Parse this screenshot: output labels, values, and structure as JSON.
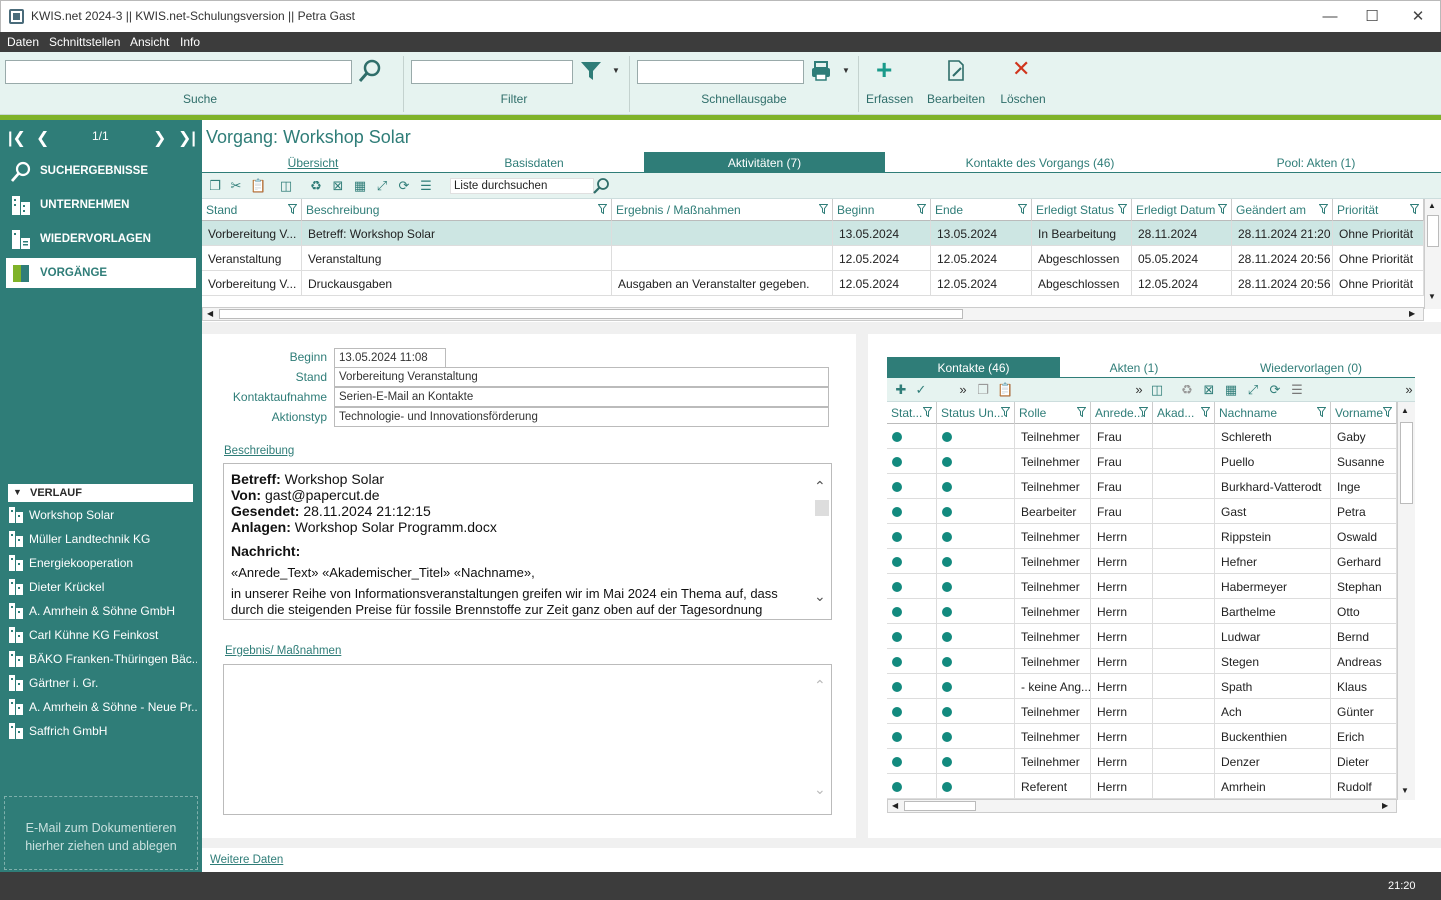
{
  "window": {
    "title": "KWIS.net 2024-3 || KWIS.net-Schulungsversion || Petra Gast"
  },
  "menu": [
    "Daten",
    "Schnittstellen",
    "Ansicht",
    "Info"
  ],
  "toolbar": {
    "search_label": "Suche",
    "filter_label": "Filter",
    "quick_label": "Schnellausgabe",
    "add_label": "Erfassen",
    "edit_label": "Bearbeiten",
    "delete_label": "Löschen"
  },
  "nav": {
    "pager": "1/1",
    "items": [
      "SUCHERGEBNISSE",
      "UNTERNEHMEN",
      "WIEDERVORLAGEN",
      "VORGÄNGE"
    ],
    "verlauf": "VERLAUF",
    "history": [
      "Workshop Solar",
      "Müller Landtechnik KG",
      "Energiekooperation",
      "Dieter Krückel",
      "A. Amrhein & Söhne GmbH",
      "Carl Kühne KG Feinkost",
      "BÄKO Franken-Thüringen Bäc...",
      "Gärtner i. Gr.",
      "A. Amrhein & Söhne - Neue Pr...",
      "Saffrich GmbH"
    ],
    "drop_text_1": "E-Mail  zum Dokumentieren",
    "drop_text_2": "hierher ziehen und ablegen"
  },
  "vorgang": {
    "title": "Vorgang: Workshop Solar",
    "tabs": [
      "Übersicht",
      "Basisdaten",
      "Aktivitäten (7)",
      "Kontakte des Vorgangs (46)",
      "Pool: Akten (1)"
    ],
    "search_placeholder": "Liste durchsuchen",
    "columns": [
      "Stand",
      "Beschreibung",
      "Ergebnis / Maßnahmen",
      "Beginn",
      "Ende",
      "Erledigt Status",
      "Erledigt Datum",
      "Geändert am",
      "Priorität"
    ],
    "rows": [
      [
        "Vorbereitung  V...",
        "Betreff: Workshop Solar",
        "",
        "13.05.2024",
        "13.05.2024",
        "In Bearbeitung",
        "28.11.2024",
        "28.11.2024 21:20",
        "Ohne Priorität"
      ],
      [
        "Veranstaltung",
        "Veranstaltung",
        "",
        "12.05.2024",
        "12.05.2024",
        "Abgeschlossen",
        "05.05.2024",
        "28.11.2024 20:56",
        "Ohne Priorität"
      ],
      [
        "Vorbereitung  V...",
        "Druckausgaben",
        "Ausgaben an Veranstalter gegeben.",
        "12.05.2024",
        "12.05.2024",
        "Abgeschlossen",
        "12.05.2024",
        "28.11.2024 20:56",
        "Ohne Priorität"
      ]
    ]
  },
  "detail": {
    "beginn_label": "Beginn",
    "beginn": "13.05.2024 11:08",
    "stand_label": "Stand",
    "stand": "Vorbereitung Veranstaltung",
    "kontakt_label": "Kontaktaufnahme",
    "kontakt": "Serien-E-Mail an Kontakte",
    "aktion_label": "Aktionstyp",
    "aktion": "Technologie- und Innovationsförderung",
    "beschreibung_label": "Beschreibung",
    "mail": {
      "betreff_k": "Betreff:",
      "betreff": " Workshop Solar",
      "von_k": "Von:",
      "von": " gast@papercut.de",
      "gesendet_k": "Gesendet:",
      "gesendet": " 28.11.2024 21:12:15",
      "anlagen_k": "Anlagen:",
      "anlagen": " Workshop Solar Programm.docx",
      "nachricht": "Nachricht:",
      "anrede": "«Anrede_Text» «Akademischer_Titel» «Nachname»,",
      "text1": "in unserer Reihe von Informationsveranstaltungen greifen wir im Mai 2024 ein Thema auf, dass",
      "text2": "durch die steigenden Preise für fossile Brennstoffe zur Zeit ganz oben auf der Tagesordnung"
    },
    "ergebnis_label": "Ergebnis/ Maßnahmen",
    "weitere": "Weitere Daten"
  },
  "contacts": {
    "tabs": [
      "Kontakte (46)",
      "Akten (1)",
      "Wiedervorlagen (0)"
    ],
    "columns": [
      "Stat...",
      "Status  Un...",
      "Rolle",
      "Anrede...",
      "Akad...",
      "Nachname",
      "Vorname"
    ],
    "rows": [
      [
        "Teilnehmer",
        "Frau",
        "",
        "Schlereth",
        "Gaby"
      ],
      [
        "Teilnehmer",
        "Frau",
        "",
        "Puello",
        "Susanne"
      ],
      [
        "Teilnehmer",
        "Frau",
        "",
        "Burkhard-Vatterodt",
        "Inge"
      ],
      [
        "Bearbeiter",
        "Frau",
        "",
        "Gast",
        "Petra"
      ],
      [
        "Teilnehmer",
        "Herrn",
        "",
        "Rippstein",
        "Oswald"
      ],
      [
        "Teilnehmer",
        "Herrn",
        "",
        "Hefner",
        "Gerhard"
      ],
      [
        "Teilnehmer",
        "Herrn",
        "",
        "Habermeyer",
        "Stephan"
      ],
      [
        "Teilnehmer",
        "Herrn",
        "",
        "Barthelme",
        "Otto"
      ],
      [
        "Teilnehmer",
        "Herrn",
        "",
        "Ludwar",
        "Bernd"
      ],
      [
        "Teilnehmer",
        "Herrn",
        "",
        "Stegen",
        "Andreas"
      ],
      [
        "- keine Ang...",
        "Herrn",
        "",
        "Spath",
        "Klaus"
      ],
      [
        "Teilnehmer",
        "Herrn",
        "",
        "Ach",
        "Günter"
      ],
      [
        "Teilnehmer",
        "Herrn",
        "",
        "Buckenthien",
        "Erich"
      ],
      [
        "Teilnehmer",
        "Herrn",
        "",
        "Denzer",
        "Dieter"
      ],
      [
        "Referent",
        "Herrn",
        "",
        "Amrhein",
        "Rudolf"
      ]
    ]
  },
  "status": {
    "time": "21:20"
  },
  "colors": {
    "accent": "#2f7d78",
    "brand_green": "#7fb229",
    "dot": "#138a7e"
  }
}
